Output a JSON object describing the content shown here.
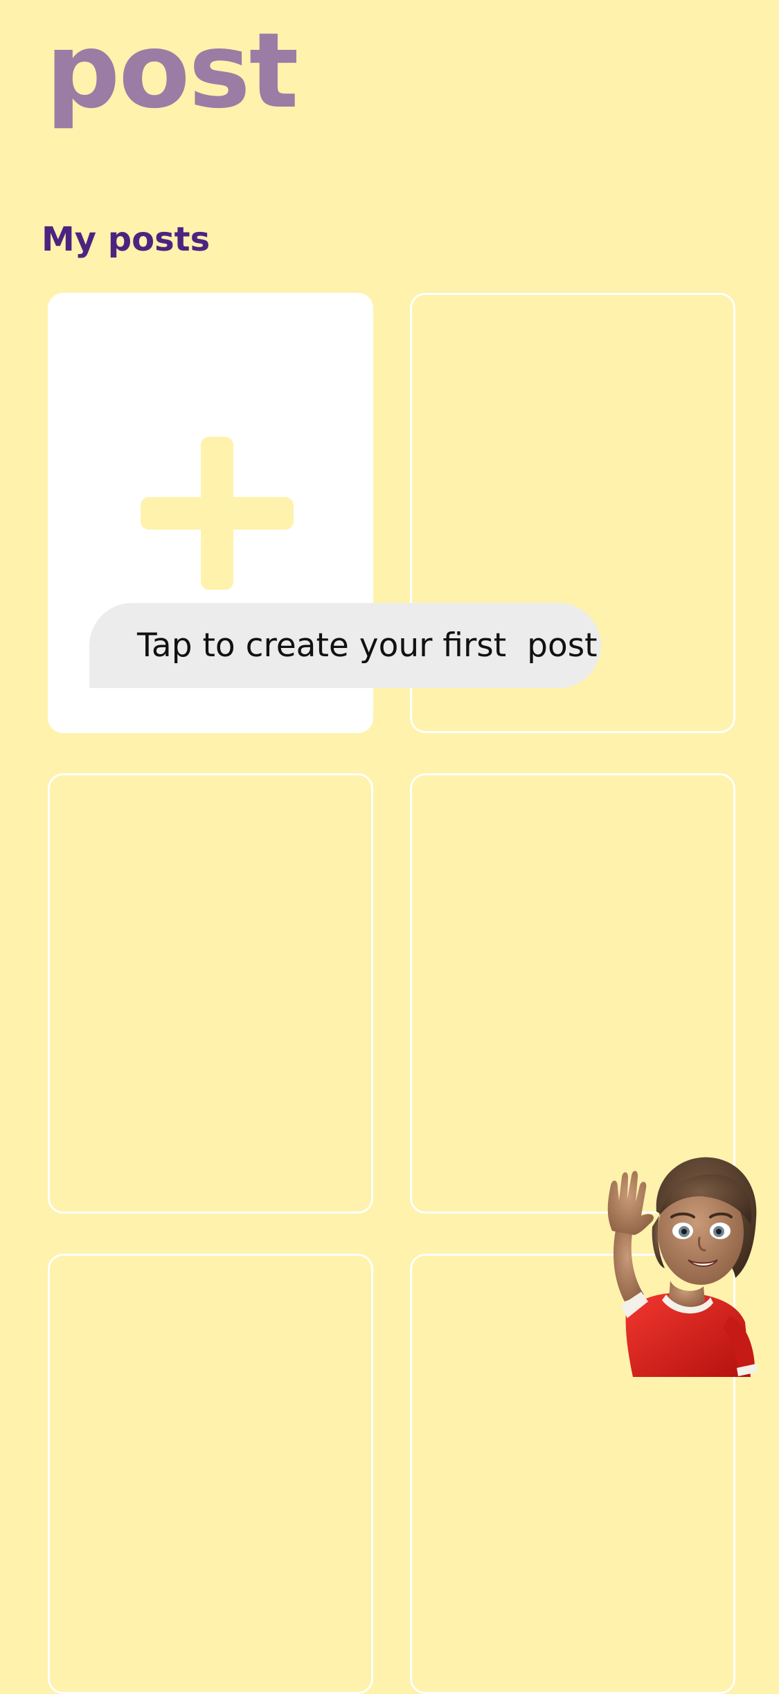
{
  "header": {
    "app_title": "post"
  },
  "main": {
    "section_title": "My posts",
    "create_tooltip": "Tap to create your first  post"
  },
  "colors": {
    "background": "#fef2ad",
    "title": "#9b7ca4",
    "section_title": "#4d2380",
    "tile_border": "#ffffff",
    "tooltip_bg": "#ececec",
    "avatar_shirt": "#e0201c"
  },
  "icons": {
    "create_post": "plus-icon",
    "mascot": "waving-avatar"
  }
}
